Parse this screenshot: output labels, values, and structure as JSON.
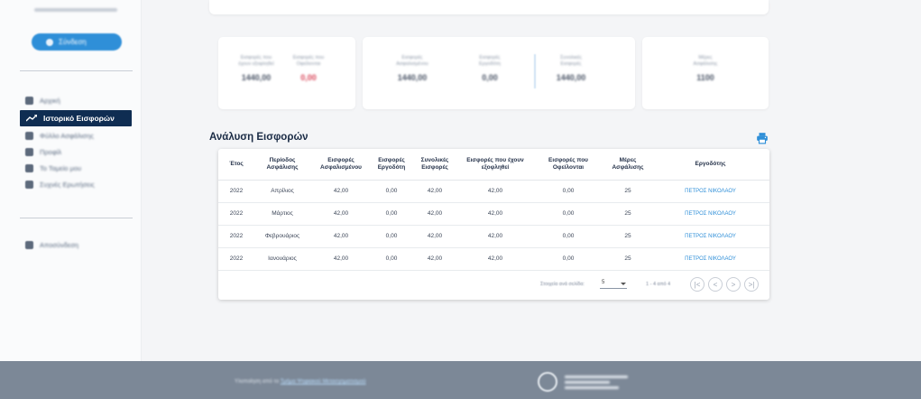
{
  "sidebar": {
    "user_name": "Πέτρος Νικολάου",
    "connect_label": "Σύνδεση",
    "items": [
      {
        "label": "Αρχική",
        "icon": "home-icon"
      },
      {
        "label": "Ιστορικό Εισφορών",
        "icon": "trending-up-icon",
        "active": true
      },
      {
        "label": "Φύλλο Ασφάλισης",
        "icon": "card-icon"
      },
      {
        "label": "Προφίλ",
        "icon": "person-icon"
      },
      {
        "label": "Το Ταμείο μου",
        "icon": "group-icon"
      },
      {
        "label": "Συχνές Ερωτήσεις",
        "icon": "help-icon"
      }
    ],
    "logout_label": "Αποσύνδεση"
  },
  "summary": {
    "card1": [
      {
        "caption1": "Εισφορές που",
        "caption2": "έχουν εξοφληθεί",
        "value": "1440,00"
      },
      {
        "caption1": "Εισφορές που",
        "caption2": "Οφείλονται",
        "value": "0,00"
      }
    ],
    "card2": [
      {
        "caption1": "Εισφορές",
        "caption2": "Ασφαλισμένου",
        "value": "1440,00"
      },
      {
        "caption1": "Εισφορές",
        "caption2": "Εργοδότη",
        "value": "0,00"
      },
      {
        "caption1": "Συνολικές",
        "caption2": "Εισφορές",
        "value": "1440,00"
      }
    ],
    "card3": [
      {
        "caption1": "Μέρες",
        "caption2": "Ασφάλισης",
        "value": "1100"
      }
    ]
  },
  "section_title": "Ανάλυση Εισφορών",
  "table": {
    "headers": [
      "Έτος",
      "Περίοδος Ασφάλισης",
      "Εισφορές Ασφαλισμένου",
      "Εισφορές Εργοδότη",
      "Συνολικές Εισφορές",
      "Εισφορές που έχουν εξοφληθεί",
      "Εισφορές που Οφείλονται",
      "Μέρες Ασφάλισης",
      "Εργοδότης"
    ],
    "rows": [
      [
        "2022",
        "Απρίλιος",
        "42,00",
        "0,00",
        "42,00",
        "42,00",
        "0,00",
        "25",
        "ΠΕΤΡΟΣ ΝΙΚΟΛΑΟΥ"
      ],
      [
        "2022",
        "Μάρτιος",
        "42,00",
        "0,00",
        "42,00",
        "42,00",
        "0,00",
        "25",
        "ΠΕΤΡΟΣ ΝΙΚΟΛΑΟΥ"
      ],
      [
        "2022",
        "Φεβρουάριος",
        "42,00",
        "0,00",
        "42,00",
        "42,00",
        "0,00",
        "25",
        "ΠΕΤΡΟΣ ΝΙΚΟΛΑΟΥ"
      ],
      [
        "2022",
        "Ιανουάριος",
        "42,00",
        "0,00",
        "42,00",
        "42,00",
        "0,00",
        "25",
        "ΠΕΤΡΟΣ ΝΙΚΟΛΑΟΥ"
      ]
    ]
  },
  "pagination": {
    "rows_per_page_label": "Στοιχεία ανά σελίδα:",
    "rows_per_page_value": "5",
    "range": "1 - 4 από 4",
    "first": "|<",
    "prev": "<",
    "next": ">",
    "last": ">|"
  },
  "footer": {
    "text": "Υλοποίηση από το",
    "link": "Τμήμα Ψηφιακού Μετασχηματισμού",
    "org_lines": [
      "ΕΛΛΗΝΙΚΗ ΔΗΜΟΚΡΑΤΙΑ",
      "Υπουργείο Εργασίας",
      "και Κοινωνικών Υποθέσεων"
    ]
  },
  "colors": {
    "accent": "#2f8fd8",
    "nav_active": "#0f2d52",
    "negative": "#d9475a",
    "footer": "#7c8897"
  }
}
